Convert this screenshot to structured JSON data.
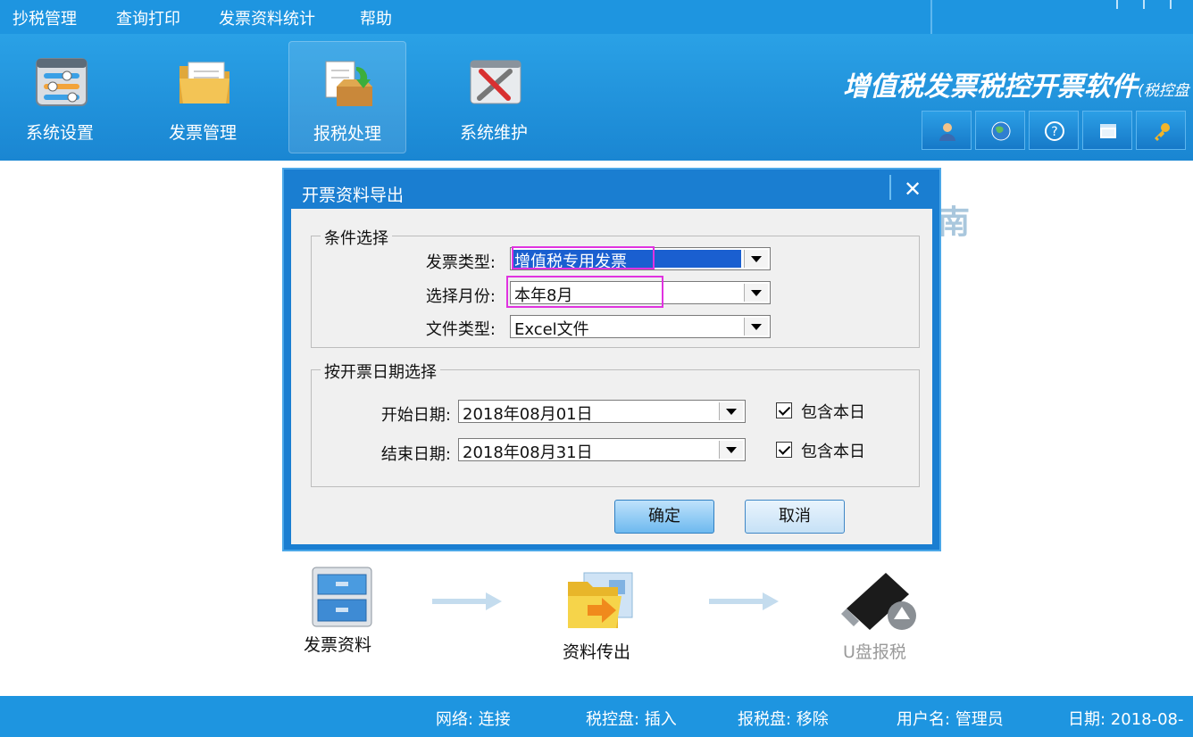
{
  "menu": {
    "items": [
      "抄税管理",
      "查询打印",
      "发票资料统计",
      "帮助"
    ]
  },
  "toolbar": {
    "items": [
      {
        "label": "系统设置",
        "icon": "settings-icon"
      },
      {
        "label": "发票管理",
        "icon": "folder-icon"
      },
      {
        "label": "报税处理",
        "icon": "tax-report-icon"
      },
      {
        "label": "系统维护",
        "icon": "tools-icon"
      }
    ],
    "active": "报税处理"
  },
  "brand": {
    "title": "增值税发票税控开票软件",
    "suffix": "(税控盘"
  },
  "quickbar": {
    "icons": [
      "user-icon",
      "globe-icon",
      "help-icon",
      "window-icon",
      "key-icon"
    ]
  },
  "background": {
    "guide_text": "南"
  },
  "flow": {
    "steps": [
      {
        "label": "发票资料",
        "icon": "cabinet-icon"
      },
      {
        "label": "资料传出",
        "icon": "transfer-folder-icon"
      },
      {
        "label": "U盘报税",
        "icon": "usb-drive-icon"
      }
    ]
  },
  "dialog": {
    "title": "开票资料导出",
    "close": "✕",
    "cond_group": {
      "title": "条件选择",
      "invoice_type_label": "发票类型:",
      "invoice_type_value": "增值税专用发票",
      "month_label": "选择月份:",
      "month_value": "本年8月",
      "file_type_label": "文件类型:",
      "file_type_value": "Excel文件"
    },
    "date_group": {
      "title": "按开票日期选择",
      "start_label": "开始日期:",
      "start_value": "2018年08月01日",
      "start_include": "包含本日",
      "end_label": "结束日期:",
      "end_value": "2018年08月31日",
      "end_include": "包含本日"
    },
    "ok": "确定",
    "cancel": "取消"
  },
  "status": {
    "network": "网络: 连接",
    "tax_disk": "税控盘: 插入",
    "report_disk": "报税盘: 移除",
    "user": "用户名: 管理员",
    "date": "日期: 2018-08-"
  },
  "colors": {
    "accent": "#1e95e0",
    "highlight": "#e032e0",
    "selection": "#1a5fd0"
  }
}
